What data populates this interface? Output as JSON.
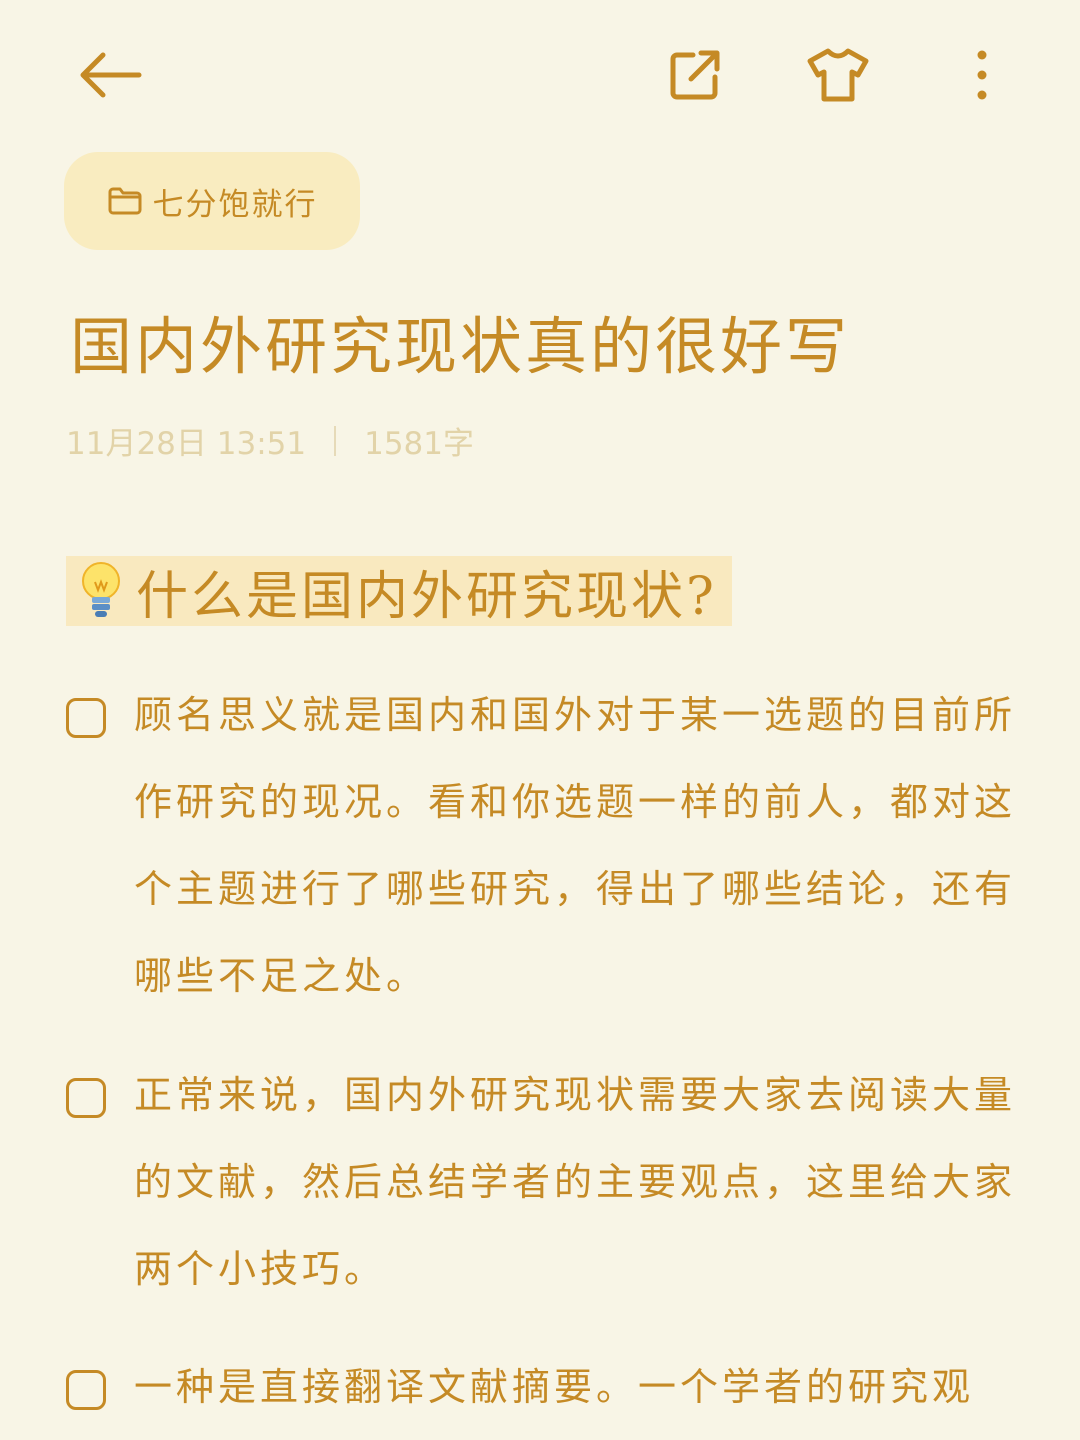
{
  "folder": {
    "label": "七分饱就行",
    "icon": "folder-icon"
  },
  "note": {
    "title": "国内外研究现状真的很好写",
    "date": "11月28日 13:51",
    "word_count": "1581字"
  },
  "section_heading": {
    "icon": "lightbulb-icon",
    "text": "什么是国内外研究现状?"
  },
  "tasks": [
    {
      "text": "顾名思义就是国内和国外对于某一选题的目前所作研究的现况。看和你选题一样的前人，都对这个主题进行了哪些研究，得出了哪些结论，还有哪些不足之处。",
      "checked": false
    },
    {
      "text": "正常来说，国内外研究现状需要大家去阅读大量的文献，然后总结学者的主要观点，这里给大家两个小技巧。",
      "checked": false
    },
    {
      "text": "一种是直接翻译文献摘要。一个学者的研究观",
      "checked": false
    }
  ],
  "toolbar": {
    "back_icon": "arrow-left-icon",
    "share_icon": "share-external-icon",
    "theme_icon": "tshirt-icon",
    "more_icon": "more-vertical-icon"
  },
  "colors": {
    "accent": "#c58a25",
    "background": "#f8f5e6",
    "chip": "#f9ecc0",
    "highlight": "#f9e9bf",
    "meta": "#e2d3a8"
  }
}
